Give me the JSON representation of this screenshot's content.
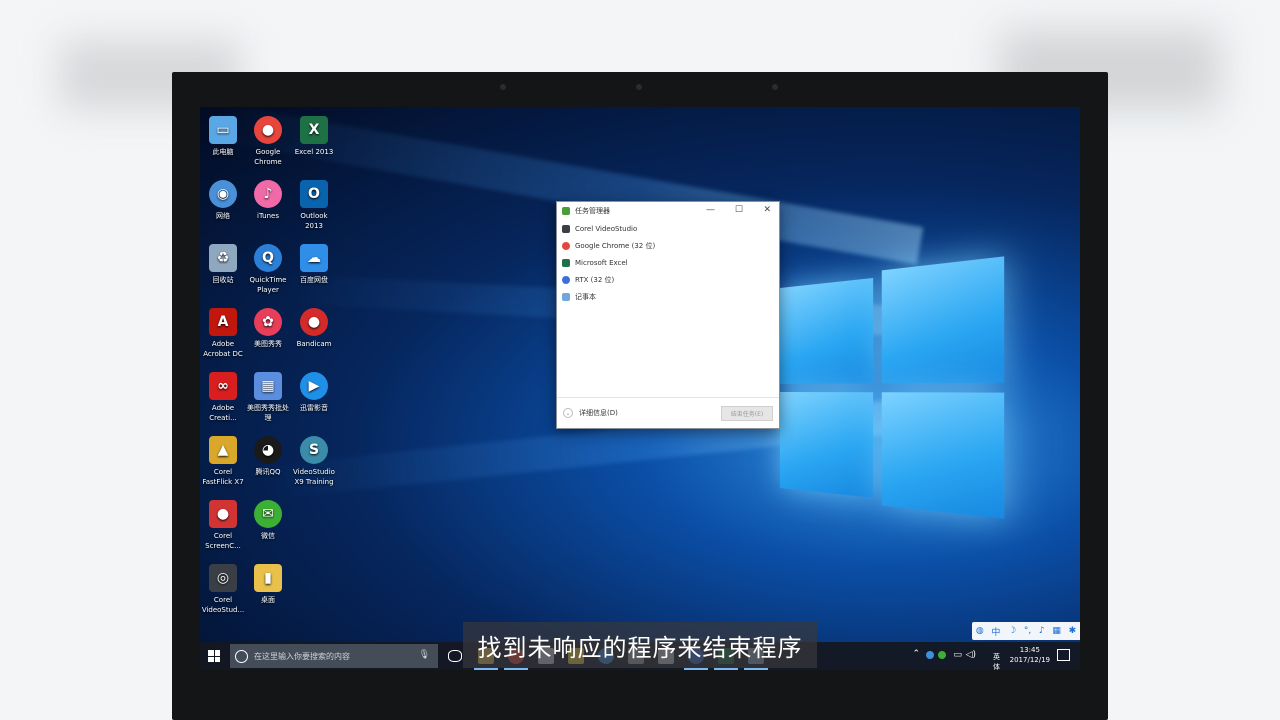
{
  "desktop_icons": [
    {
      "label": "此电脑",
      "icon": "computer-icon",
      "color": "#5aa7e6"
    },
    {
      "label": "Google Chrome",
      "icon": "chrome-icon",
      "color": "#e8453c"
    },
    {
      "label": "Excel 2013",
      "icon": "excel-icon",
      "color": "#1e7145"
    },
    {
      "label": "网络",
      "icon": "network-icon",
      "color": "#4a90d9"
    },
    {
      "label": "iTunes",
      "icon": "itunes-icon",
      "color": "#f06aa8"
    },
    {
      "label": "Outlook 2013",
      "icon": "outlook-icon",
      "color": "#0a64ad"
    },
    {
      "label": "回收站",
      "icon": "recycle-bin-icon",
      "color": "#8fa8c0"
    },
    {
      "label": "QuickTime Player",
      "icon": "quicktime-icon",
      "color": "#2c7fd6"
    },
    {
      "label": "百度网盘",
      "icon": "baidu-netdisk-icon",
      "color": "#2f8ee8"
    },
    {
      "label": "Adobe Acrobat DC",
      "icon": "acrobat-icon",
      "color": "#c2170d"
    },
    {
      "label": "美图秀秀",
      "icon": "meitu-icon",
      "color": "#e83e5a"
    },
    {
      "label": "Bandicam",
      "icon": "bandicam-icon",
      "color": "#d42a2a"
    },
    {
      "label": "Adobe Creati...",
      "icon": "creative-cloud-icon",
      "color": "#d81e1e"
    },
    {
      "label": "美图秀秀批处理",
      "icon": "meitu-batch-icon",
      "color": "#5c8ee0"
    },
    {
      "label": "迅雷影音",
      "icon": "xunlei-player-icon",
      "color": "#1f8fe8"
    },
    {
      "label": "Corel FastFlick X7",
      "icon": "fastflick-icon",
      "color": "#d9a72a"
    },
    {
      "label": "腾讯QQ",
      "icon": "qq-icon",
      "color": "#1a1a1a"
    },
    {
      "label": "VideoStudio X9 Training",
      "icon": "videostudio-training-icon",
      "color": "#3a8ca8"
    },
    {
      "label": "Corel ScreenC...",
      "icon": "screencap-icon",
      "color": "#d23434"
    },
    {
      "label": "微信",
      "icon": "wechat-icon",
      "color": "#3cb034"
    },
    {
      "label": "Corel VideoStud...",
      "icon": "videostudio-icon",
      "color": "#3a3f45"
    },
    {
      "label": "桌面",
      "icon": "folder-icon",
      "color": "#e8c04a"
    }
  ],
  "task_manager": {
    "title": "任务管理器",
    "apps": [
      {
        "name": "Corel VideoStudio",
        "icon": "videostudio-icon",
        "color": "#3a3f45"
      },
      {
        "name": "Google Chrome (32 位)",
        "icon": "chrome-icon",
        "color": "#e8453c"
      },
      {
        "name": "Microsoft Excel",
        "icon": "excel-icon",
        "color": "#1e7145"
      },
      {
        "name": "RTX (32 位)",
        "icon": "rtx-icon",
        "color": "#3d6fd8"
      },
      {
        "name": "记事本",
        "icon": "notepad-icon",
        "color": "#6fa8dc"
      }
    ],
    "more_details": "详细信息(D)",
    "end_task": "结束任务(E)"
  },
  "taskbar": {
    "search_placeholder": "在这里输入你要搜索的内容",
    "apps": [
      {
        "icon": "file-explorer-icon",
        "color": "#e8c04a"
      },
      {
        "icon": "chrome-icon",
        "color": "#e8453c"
      },
      {
        "icon": "mail-icon",
        "color": "#d0d4da"
      },
      {
        "icon": "sticky-notes-icon",
        "color": "#f4d03f"
      },
      {
        "icon": "globe-icon",
        "color": "#3d8fe0"
      },
      {
        "icon": "photos-icon",
        "color": "#a0a8b4"
      },
      {
        "icon": "camera-icon",
        "color": "#c7ccd3"
      },
      {
        "icon": "rtx-icon",
        "color": "#3d6fd8"
      },
      {
        "icon": "excel-icon",
        "color": "#1e7145"
      },
      {
        "icon": "task-manager-icon",
        "color": "#8fa8c0"
      }
    ],
    "ime_mode": "英体",
    "time": "13:45",
    "date": "2017/12/19"
  },
  "ime_bar": {
    "lang": "中"
  },
  "subtitle": "找到未响应的程序来结束程序"
}
